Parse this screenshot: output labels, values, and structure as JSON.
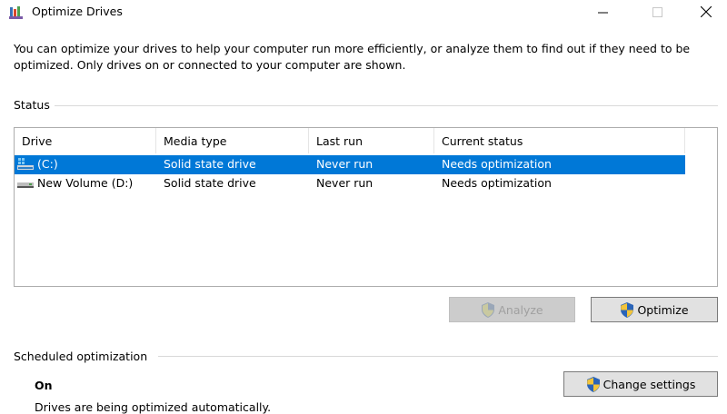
{
  "window": {
    "title": "Optimize Drives",
    "icon": "defrag-app-icon",
    "controls": [
      "minimize-icon",
      "maximize-icon",
      "close-icon"
    ]
  },
  "description": "You can optimize your drives to help your computer run more efficiently, or analyze them to find out if they need to be optimized. Only drives on or connected to your computer are shown.",
  "status": {
    "label": "Status",
    "columns": [
      "Drive",
      "Media type",
      "Last run",
      "Current status"
    ],
    "rows": [
      {
        "drive": "(C:)",
        "media_type": "Solid state drive",
        "last_run": "Never run",
        "current_status": "Needs optimization",
        "selected": true,
        "icon": "system-drive-icon"
      },
      {
        "drive": "New Volume (D:)",
        "media_type": "Solid state drive",
        "last_run": "Never run",
        "current_status": "Needs optimization",
        "selected": false,
        "icon": "drive-icon"
      }
    ]
  },
  "buttons": {
    "analyze": "Analyze",
    "optimize": "Optimize",
    "change_settings": "Change settings"
  },
  "scheduled": {
    "label": "Scheduled optimization",
    "state": "On",
    "detail": "Drives are being optimized automatically."
  },
  "colors": {
    "selection": "#0078d7",
    "button_face": "#e1e1e1",
    "disabled_button": "#cccccc"
  }
}
